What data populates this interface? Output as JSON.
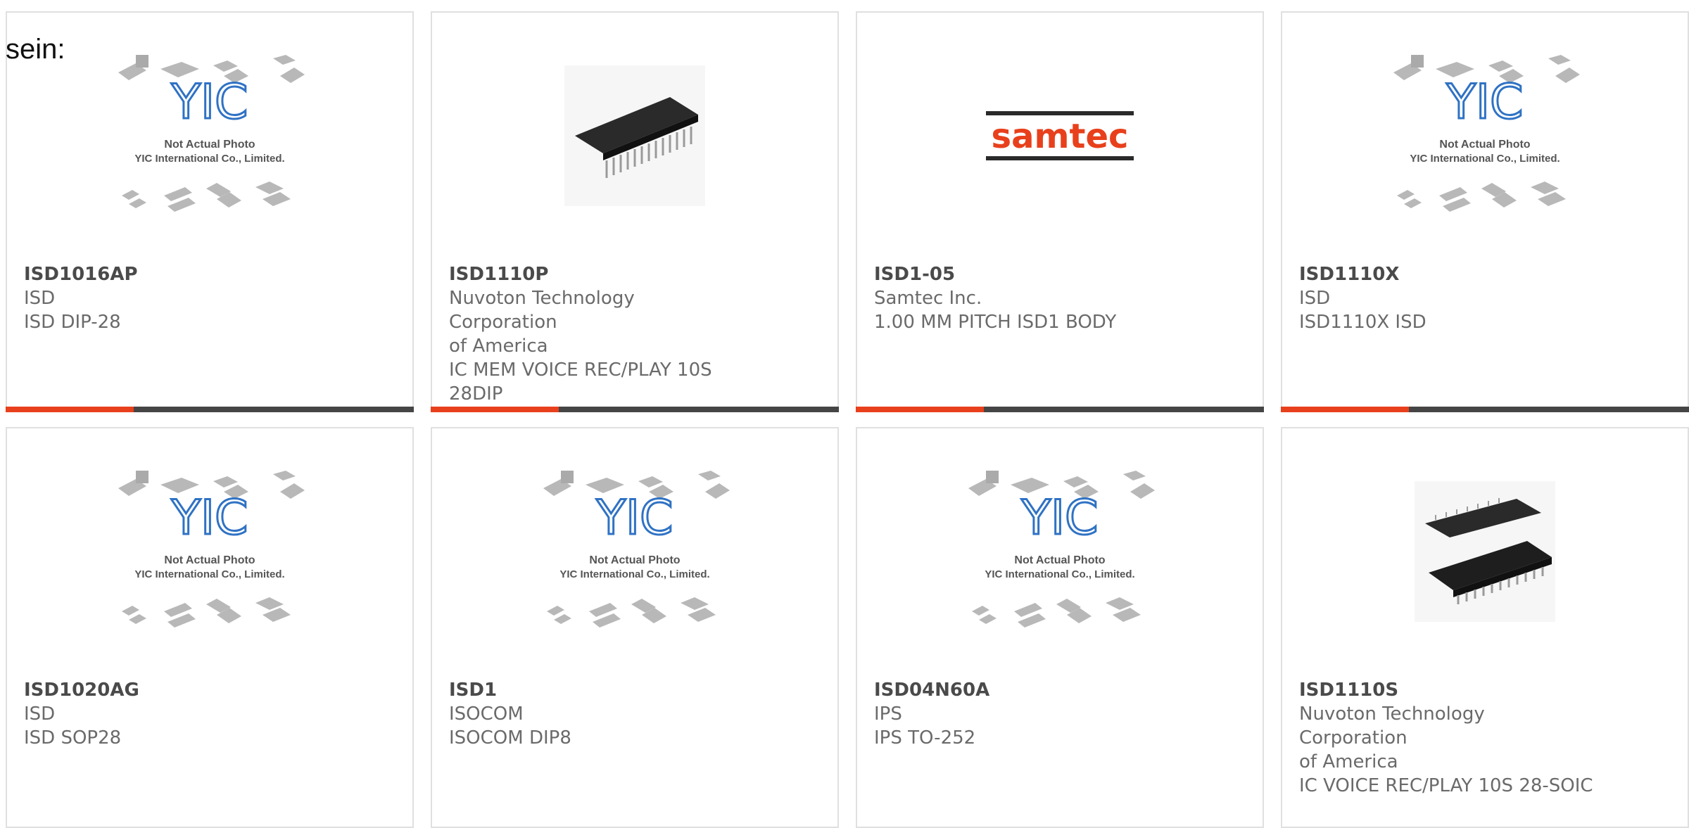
{
  "lead_text": "sein:",
  "colors": {
    "accent": "#e8401c",
    "bar": "#454545",
    "yic_blue": "#2f72c4"
  },
  "placeholder_image": {
    "line1": "Not Actual Photo",
    "line2": "YIC International Co., Limited.",
    "logo": "YIC"
  },
  "samtec_logo": "samtec",
  "products": [
    {
      "part": "ISD1016AP",
      "lines": [
        "ISD",
        "ISD DIP-28"
      ],
      "image": "yic-placeholder"
    },
    {
      "part": "ISD1110P",
      "lines": [
        "Nuvoton Technology Corporation",
        "of America",
        "IC MEM VOICE REC/PLAY 10S",
        "28DIP"
      ],
      "image": "dip-chip-photo"
    },
    {
      "part": "ISD1-05",
      "lines": [
        "Samtec Inc.",
        "1.00 MM PITCH ISD1 BODY"
      ],
      "image": "samtec-logo"
    },
    {
      "part": "ISD1110X",
      "lines": [
        "ISD",
        "ISD1110X ISD"
      ],
      "image": "yic-placeholder"
    },
    {
      "part": "ISD1020AG",
      "lines": [
        "ISD",
        "ISD SOP28"
      ],
      "image": "yic-placeholder"
    },
    {
      "part": "ISD1",
      "lines": [
        "ISOCOM",
        "ISOCOM DIP8"
      ],
      "image": "yic-placeholder"
    },
    {
      "part": "ISD04N60A",
      "lines": [
        "IPS",
        "IPS TO-252"
      ],
      "image": "yic-placeholder"
    },
    {
      "part": "ISD1110S",
      "lines": [
        "Nuvoton Technology Corporation",
        "of America",
        "IC VOICE REC/PLAY 10S 28-SOIC"
      ],
      "image": "soic-chip-photo"
    }
  ]
}
